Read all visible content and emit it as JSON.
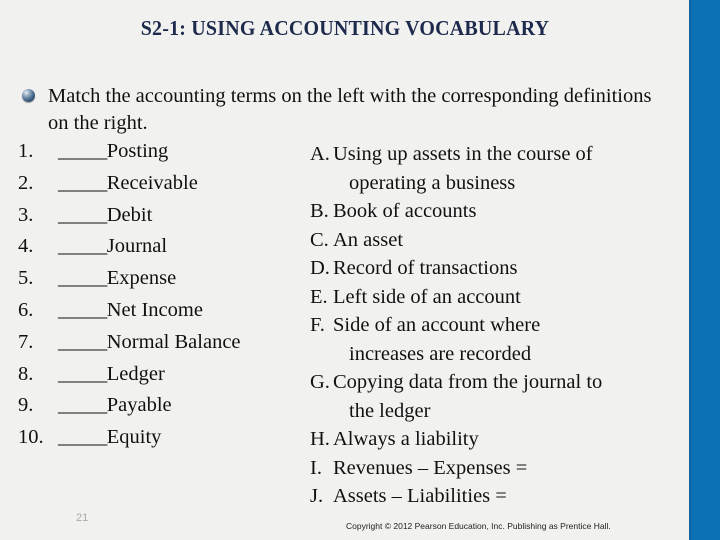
{
  "slide": {
    "title": "S2-1:  USING ACCOUNTING VOCABULARY",
    "background_color": "#f1f1ef",
    "accent_color": "#0a72b4",
    "title_color": "#1d2a4d"
  },
  "intro": {
    "bullet_icon": "sphere-bullet-icon",
    "text": "Match the accounting terms on the left with the corresponding definitions on the right."
  },
  "terms": [
    {
      "number": "1.",
      "blank": "_____",
      "label": "Posting"
    },
    {
      "number": "2.",
      "blank": "_____",
      "label": " Receivable"
    },
    {
      "number": "3.",
      "blank": "_____",
      "label": " Debit"
    },
    {
      "number": "4.",
      "blank": "_____",
      "label": " Journal"
    },
    {
      "number": "5.",
      "blank": "_____",
      "label": " Expense"
    },
    {
      "number": "6.",
      "blank": "_____",
      "label": " Net Income"
    },
    {
      "number": "7.",
      "blank": "_____",
      "label": " Normal Balance"
    },
    {
      "number": "8.",
      "blank": "_____",
      "label": " Ledger"
    },
    {
      "number": "9.",
      "blank": "_____",
      "label": " Payable"
    },
    {
      "number": "10.",
      "blank": "_____",
      "label": " Equity"
    }
  ],
  "definitions": [
    {
      "letter": "A.",
      "line1": "Using up assets in the course of",
      "line2": "operating a business"
    },
    {
      "letter": "B.",
      "line1": "Book of accounts",
      "line2": ""
    },
    {
      "letter": "C.",
      "line1": "An asset",
      "line2": ""
    },
    {
      "letter": "D.",
      "line1": "Record of transactions",
      "line2": ""
    },
    {
      "letter": "E.",
      "line1": "Left side of an account",
      "line2": ""
    },
    {
      "letter": "F.",
      "line1": "Side of an account where",
      "line2": "increases are recorded"
    },
    {
      "letter": "G.",
      "line1": "Copying data from the journal to",
      "line2": "the ledger"
    },
    {
      "letter": "H.",
      "line1": "Always a liability",
      "line2": ""
    },
    {
      "letter": "I.",
      "line1": "Revenues – Expenses =",
      "line2": ""
    },
    {
      "letter": "J.",
      "line1": "Assets – Liabilities =",
      "line2": ""
    }
  ],
  "footer": {
    "page_number": "21",
    "copyright": "Copyright © 2012 Pearson Education, Inc. Publishing as Prentice Hall."
  }
}
